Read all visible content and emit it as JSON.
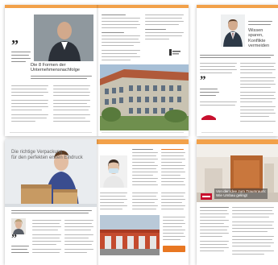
{
  "colors": {
    "accent_orange": "#e87722",
    "accent_orange_light": "#f2a14a",
    "accent_red": "#c8102e",
    "body_text": "#222222",
    "grey_text": "#b9b9b9"
  },
  "spreads": {
    "top_left": {
      "quote_mark": "”",
      "headline_line1": "Die 8 Formen der",
      "headline_line2": "Unternehmensnachfolge"
    },
    "top_right": {
      "headline_line1": "Wissen sparen,",
      "headline_line2": "Konflikte",
      "headline_line3": "vermeiden"
    },
    "mid_left": {
      "headline_line1": "Die richtige Verpackung",
      "headline_line2": "für den perfekten ersten Eindruck",
      "quote_mark": "”"
    },
    "mid_right": {},
    "bottom_right": {
      "headline_line1": "Von der Idee zum Traumraum:",
      "headline_line2": "Wie Umbau gelingt"
    }
  }
}
